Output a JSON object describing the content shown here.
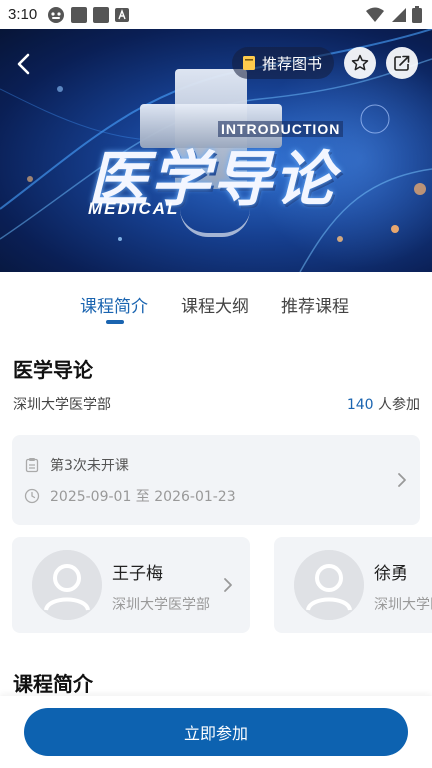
{
  "status_bar": {
    "time": "3:10",
    "icons": [
      "notification-icon",
      "app-icon",
      "app-icon",
      "font-icon",
      "wifi-icon",
      "signal-icon",
      "battery-icon"
    ]
  },
  "hero": {
    "title": "医学导论",
    "title_en_1": "INTRODUCTION",
    "title_en_2": "MEDICAL",
    "recommend_books_label": "推荐图书"
  },
  "tabs": [
    {
      "label": "课程简介",
      "active": true
    },
    {
      "label": "课程大纲",
      "active": false
    },
    {
      "label": "推荐课程",
      "active": false
    }
  ],
  "course": {
    "title": "医学导论",
    "school": "深圳大学医学部",
    "participant_count": "140",
    "participant_suffix": "人参加"
  },
  "schedule": {
    "session": "第3次未开课",
    "date_range": "2025-09-01 至 2026-01-23"
  },
  "teachers": [
    {
      "name": "王子梅",
      "school": "深圳大学医学部"
    },
    {
      "name": "徐勇",
      "school": "深圳大学医学部"
    }
  ],
  "intro_section_title": "课程简介",
  "join_button_label": "立即参加",
  "colors": {
    "accent": "#1a64b0",
    "button": "#0d62b0",
    "card_bg": "#f2f4f7"
  }
}
